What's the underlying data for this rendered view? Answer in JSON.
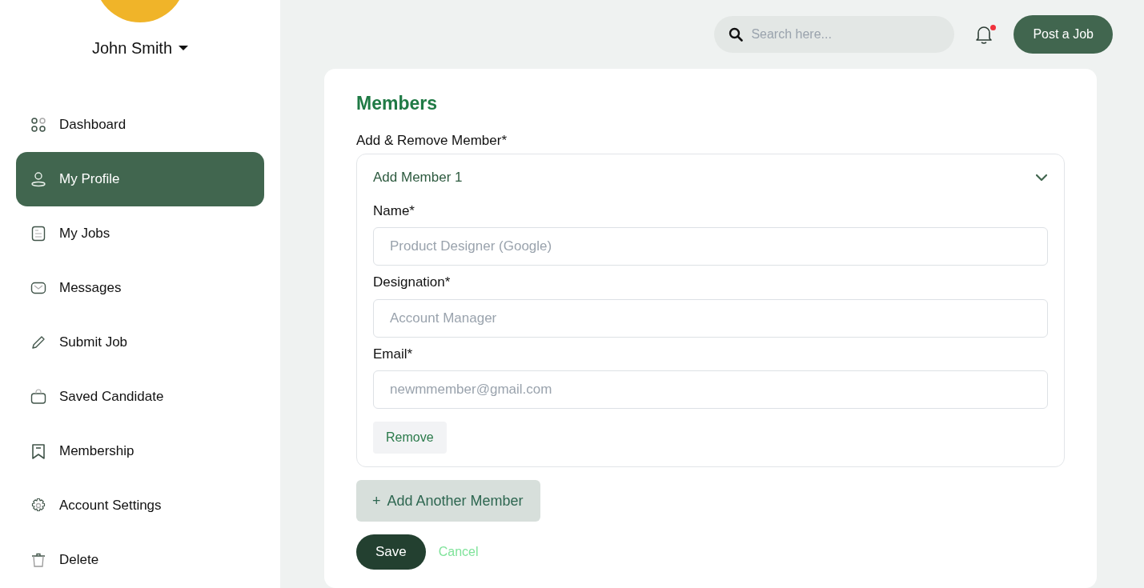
{
  "user": {
    "name": "John Smith"
  },
  "sidebar": {
    "items": [
      {
        "label": "Dashboard",
        "kind": "grid",
        "selected": false
      },
      {
        "label": "My Profile",
        "kind": "person",
        "selected": true
      },
      {
        "label": "My Jobs",
        "kind": "document",
        "selected": false
      },
      {
        "label": "Messages",
        "kind": "envelope",
        "selected": false
      },
      {
        "label": "Submit Job",
        "kind": "pencil",
        "selected": false
      },
      {
        "label": "Saved Candidate",
        "kind": "bag",
        "selected": false
      },
      {
        "label": "Membership",
        "kind": "bookmark",
        "selected": false
      },
      {
        "label": "Account Settings",
        "kind": "gear",
        "selected": false
      },
      {
        "label": "Delete",
        "kind": "trash",
        "selected": false
      }
    ]
  },
  "header": {
    "search": {
      "placeholder": "Search here..."
    },
    "notification": {
      "unread": true
    },
    "post_button": "Post a Job"
  },
  "members": {
    "title": "Members",
    "label": "Add & Remove Member*",
    "accordion": {
      "title": "Add Member 1",
      "expanded": true,
      "fields": [
        {
          "label": "Name*",
          "placeholder": "Product Designer (Google)"
        },
        {
          "label": "Designation*",
          "placeholder": "Account Manager"
        },
        {
          "label": "Email*",
          "placeholder": "newmmember@gmail.com"
        }
      ],
      "remove_button": "Remove"
    },
    "add_button": {
      "icon": "+",
      "label": "Add Another Member"
    },
    "save_button": "Save",
    "cancel_link": "Cancel"
  }
}
